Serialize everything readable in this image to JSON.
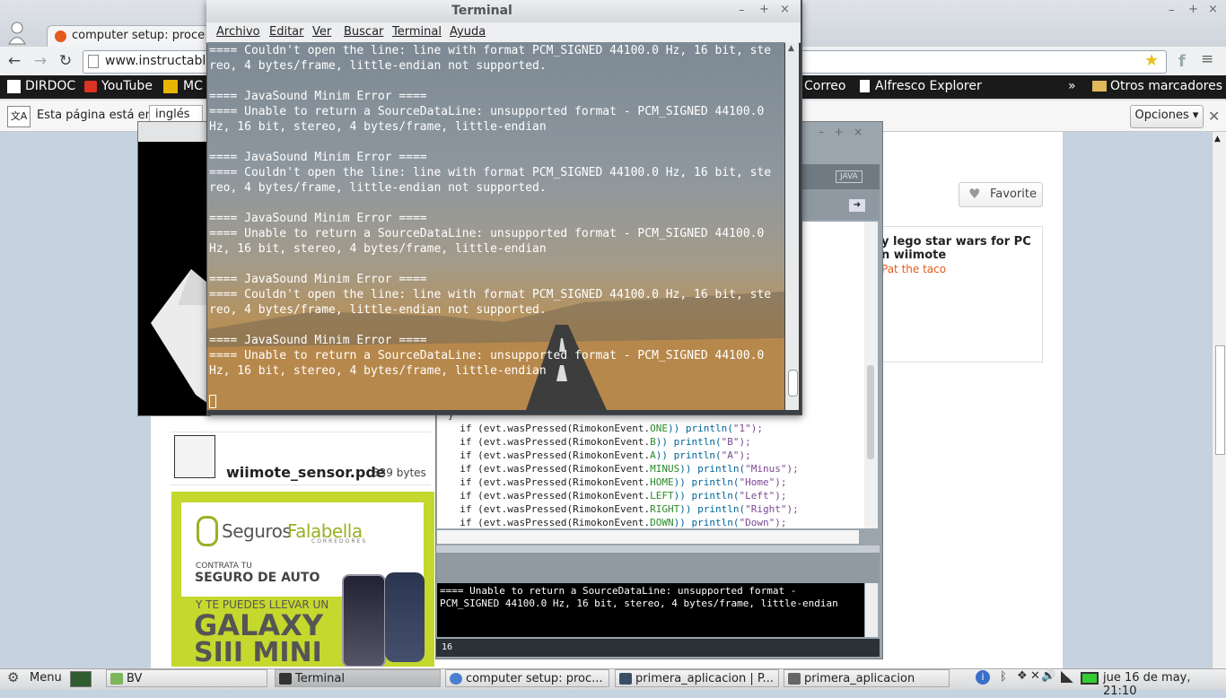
{
  "browser": {
    "tab_title": "computer setup: proce",
    "url": "www.instructabl",
    "bookmarks": [
      "DIRDOC",
      "YouTube",
      "MC",
      "Correo",
      "Alfresco Explorer",
      "»",
      "Otros marcadores"
    ],
    "translate_bar": {
      "text": "Esta página está en",
      "lang": "inglés",
      "options": "Opciones"
    }
  },
  "page": {
    "favorite": "Favorite",
    "related_title_1": "y lego star wars for PC",
    "related_title_2": "n wiimote",
    "related_author": "Pat the taco",
    "file_name": "wiimote_sensor.pde",
    "file_size": "339 bytes",
    "ad": {
      "brand_1": "Seguros",
      "brand_2": "Falabella",
      "brand_sub": "CORREDORES",
      "line1": "CONTRATA TU",
      "line2": "SEGURO DE AUTO",
      "line3": "Y TE PUEDES LLEVAR UN",
      "line4": "GALAXY",
      "line5": "SIII MINI"
    }
  },
  "ide": {
    "mode": "JAVA",
    "code": [
      {
        "p": "}",
        "s": "",
        "t": "",
        "q": ""
      },
      {
        "p": "  if (evt.wasPressed(RimokonEvent.",
        "s": "ONE",
        "t": ")) println(",
        "q": "\"1\");"
      },
      {
        "p": "  if (evt.wasPressed(RimokonEvent.",
        "s": "B",
        "t": ")) println(",
        "q": "\"B\");"
      },
      {
        "p": "  if (evt.wasPressed(RimokonEvent.",
        "s": "A",
        "t": ")) println(",
        "q": "\"A\");"
      },
      {
        "p": "  if (evt.wasPressed(RimokonEvent.",
        "s": "MINUS",
        "t": ")) println(",
        "q": "\"Minus\");"
      },
      {
        "p": "  if (evt.wasPressed(RimokonEvent.",
        "s": "HOME",
        "t": ")) println(",
        "q": "\"Home\");"
      },
      {
        "p": "  if (evt.wasPressed(RimokonEvent.",
        "s": "LEFT",
        "t": ")) println(",
        "q": "\"Left\");"
      },
      {
        "p": "  if (evt.wasPressed(RimokonEvent.",
        "s": "RIGHT",
        "t": ")) println(",
        "q": "\"Right\");"
      },
      {
        "p": "  if (evt.wasPressed(RimokonEvent.",
        "s": "DOWN",
        "t": ")) println(",
        "q": "\"Down\");"
      }
    ],
    "console_1": "==== Unable to return a SourceDataLine: unsupported format -",
    "console_2": "PCM_SIGNED 44100.0 Hz, 16 bit, stereo, 4 bytes/frame, little-endian",
    "line_number": "16"
  },
  "terminal": {
    "title": "Terminal",
    "menu": [
      "Archivo",
      "Editar",
      "Ver",
      "Buscar",
      "Terminal",
      "Ayuda"
    ],
    "lines": [
      "==== Couldn't open the line: line with format PCM_SIGNED 44100.0 Hz, 16 bit, ste",
      "reo, 4 bytes/frame, little-endian not supported.",
      "",
      "==== JavaSound Minim Error ====",
      "==== Unable to return a SourceDataLine: unsupported format - PCM_SIGNED 44100.0",
      "Hz, 16 bit, stereo, 4 bytes/frame, little-endian",
      "",
      "==== JavaSound Minim Error ====",
      "==== Couldn't open the line: line with format PCM_SIGNED 44100.0 Hz, 16 bit, ste",
      "reo, 4 bytes/frame, little-endian not supported.",
      "",
      "==== JavaSound Minim Error ====",
      "==== Unable to return a SourceDataLine: unsupported format - PCM_SIGNED 44100.0",
      "Hz, 16 bit, stereo, 4 bytes/frame, little-endian",
      "",
      "==== JavaSound Minim Error ====",
      "==== Couldn't open the line: line with format PCM_SIGNED 44100.0 Hz, 16 bit, ste",
      "reo, 4 bytes/frame, little-endian not supported.",
      "",
      "==== JavaSound Minim Error ====",
      "==== Unable to return a SourceDataLine: unsupported format - PCM_SIGNED 44100.0",
      "Hz, 16 bit, stereo, 4 bytes/frame, little-endian"
    ]
  },
  "taskbar": {
    "menu": "Menu",
    "tasks": [
      "BV",
      "Terminal",
      "computer setup: proc...",
      "primera_aplicacion | P...",
      "primera_aplicacion"
    ],
    "clock": "jue 16 de may, 21:10"
  },
  "colors": {
    "accent_orange": "#e35a1d",
    "ad_green": "#c4d82e",
    "ide_keyword": "#2a8a2a"
  }
}
